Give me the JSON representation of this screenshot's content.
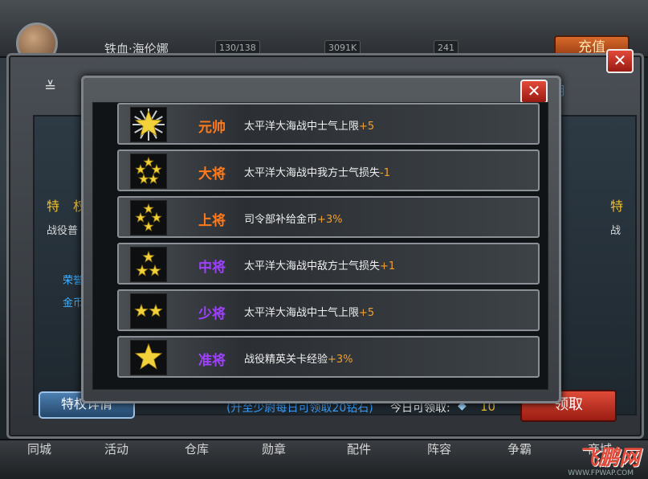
{
  "top_hud": {
    "player_name": "铁血·海伦娜",
    "stats": [
      "130/138",
      "3091K",
      "241"
    ],
    "recharge_label": "充值"
  },
  "privilege_panel": {
    "side_tag_right": "明",
    "left_title": "特 权",
    "left_text": "战役普",
    "left_honor": "荣誉",
    "left_gold": "金币",
    "right_title": "特",
    "right_text": "战",
    "detail_button": "特权详情",
    "daily_hint": "(升至少尉每日可领取20钻石)",
    "daily_label": "今日可领取:",
    "daily_count": "10",
    "claim_button": "领取",
    "close_label": "✕"
  },
  "dialog": {
    "close_label": "✕",
    "ranks": [
      {
        "name": "元帅",
        "color": "#ff7a1a",
        "effect": "太平洋大海战中士气上限",
        "bonus": "+5",
        "stars": "5-big"
      },
      {
        "name": "大将",
        "color": "#ff7a1a",
        "effect": "太平洋大海战中我方士气损失",
        "bonus": "-1",
        "stars": "5"
      },
      {
        "name": "上将",
        "color": "#ff7a1a",
        "effect": "司令部补给金币",
        "bonus": "+3%",
        "stars": "4"
      },
      {
        "name": "中将",
        "color": "#a040ff",
        "effect": "太平洋大海战中敌方士气损失",
        "bonus": "+1",
        "stars": "3"
      },
      {
        "name": "少将",
        "color": "#a040ff",
        "effect": "太平洋大海战中士气上限",
        "bonus": "+5",
        "stars": "2"
      },
      {
        "name": "准将",
        "color": "#a040ff",
        "effect": "战役精英关卡经验",
        "bonus": "+3%",
        "stars": "1"
      }
    ]
  },
  "bottom_nav": {
    "items": [
      "同城",
      "活动",
      "仓库",
      "勋章",
      "配件",
      "阵容",
      "争霸",
      "商城"
    ]
  },
  "watermark": {
    "logo": "飞鹏网",
    "url": "WWW.FPWAP.COM"
  }
}
